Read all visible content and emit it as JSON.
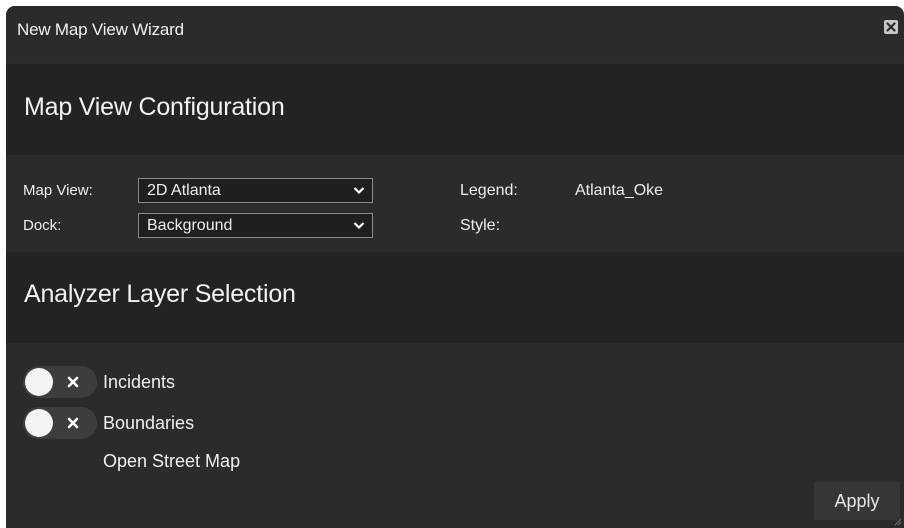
{
  "window": {
    "title": "New Map View Wizard"
  },
  "config": {
    "heading": "Map View Configuration",
    "map_view_label": "Map View:",
    "map_view_value": "2D Atlanta",
    "dock_label": "Dock:",
    "dock_value": "Background",
    "legend_label": "Legend:",
    "legend_value": "Atlanta_Oke",
    "style_label": "Style:"
  },
  "analyzer": {
    "heading": "Analyzer Layer Selection",
    "layers": [
      {
        "label": "Incidents",
        "enabled": false
      },
      {
        "label": "Boundaries",
        "enabled": false
      },
      {
        "label": "Open Street Map"
      }
    ]
  },
  "footer": {
    "apply_label": "Apply"
  },
  "icons": {
    "close": "close-icon",
    "dropdown": "chevron-down-icon",
    "toggle_off": "x-icon",
    "resize": "resize-grip-icon"
  },
  "colors": {
    "window_bg": "#2c2c2c",
    "header_bg": "#232323",
    "text": "#eeeeee"
  }
}
